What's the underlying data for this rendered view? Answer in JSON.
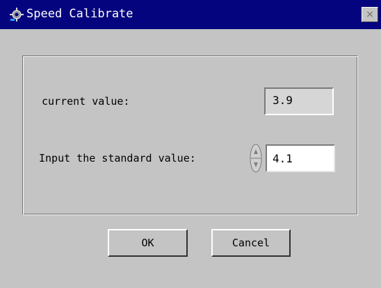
{
  "window": {
    "title": "Speed Calibrate",
    "close_glyph": "×",
    "icon": "settings-app-icon"
  },
  "form": {
    "current_label": "current value:",
    "current_value": "3.9",
    "standard_label": "Input the standard value:",
    "standard_value": "4.1"
  },
  "buttons": {
    "ok_label": "OK",
    "cancel_label": "Cancel"
  },
  "colors": {
    "titlebar": "#04047e",
    "window_bg": "#c4c4c4"
  }
}
